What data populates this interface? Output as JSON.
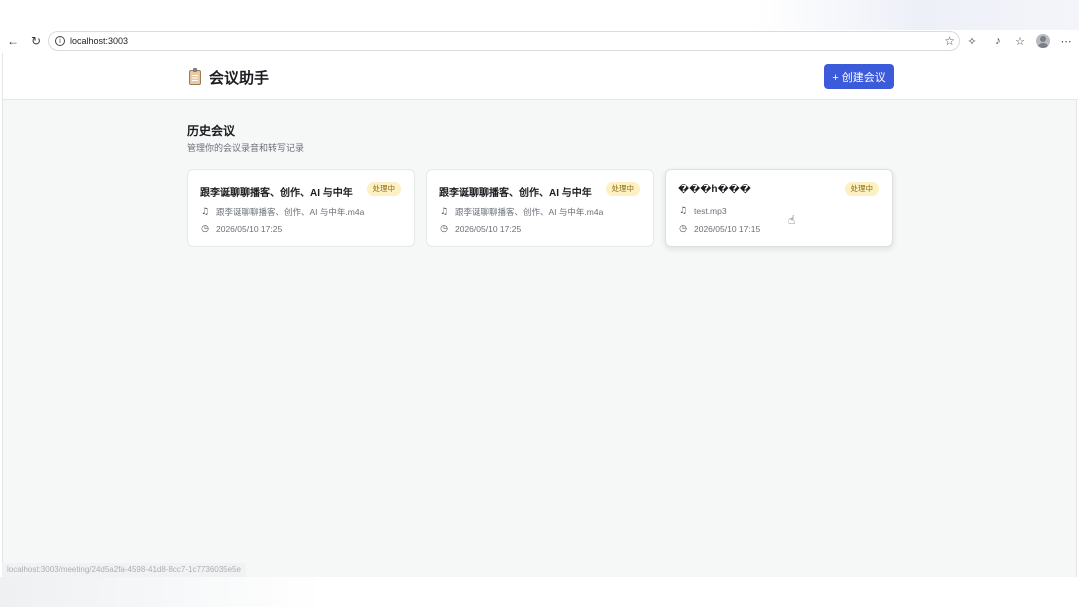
{
  "browser": {
    "url": "localhost:3003",
    "status_url": "localhost:3003/meeting/24d5a2fa-4598-41d8-8cc7-1c7736035e5e",
    "icons": {
      "back": "arrow-left-icon",
      "reload": "reload-icon",
      "site_info": "info-icon",
      "favorite": "star-icon",
      "extensions": "puzzle-icon",
      "read_aloud": "read-aloud-icon",
      "favorites_list": "favorites-icon",
      "profile": "avatar-icon",
      "menu": "more-icon"
    }
  },
  "header": {
    "title": "会议助手",
    "create_button": "+ 创建会议",
    "accent_color": "#3b5bdb"
  },
  "section": {
    "title": "历史会议",
    "subtitle": "管理你的会议录音和转写记录"
  },
  "meetings": [
    {
      "title": "跟李诞聊聊播客、创作、AI 与中年",
      "status": "处理中",
      "file": "跟李诞聊聊播客、创作、AI 与中年.m4a",
      "date": "2026/05/10 17:25"
    },
    {
      "title": "跟李诞聊聊播客、创作、AI 与中年",
      "status": "处理中",
      "file": "跟李诞聊聊播客、创作、AI 与中年.m4a",
      "date": "2026/05/10 17:25"
    },
    {
      "title": "���h���",
      "status": "处理中",
      "file": "test.mp3",
      "date": "2026/05/10 17:15"
    }
  ],
  "colors": {
    "badge_bg": "#fdf0c2",
    "badge_text": "#8a6d12",
    "page_bg": "#f6f7f7"
  }
}
